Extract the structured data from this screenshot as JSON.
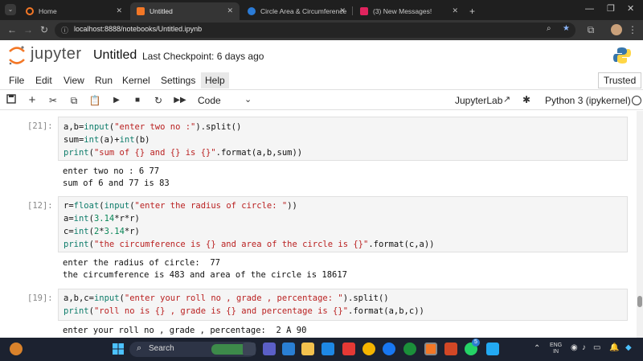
{
  "browser": {
    "tabs": [
      {
        "label": "Home",
        "active": false
      },
      {
        "label": "Untitled",
        "active": true
      },
      {
        "label": "Circle Area & Circumference",
        "active": false
      },
      {
        "label": "(3) New Messages!",
        "active": false
      }
    ],
    "new_tab_symbol": "+",
    "url": "localhost:8888/notebooks/Untitled.ipynb"
  },
  "jupyter": {
    "logo_text": "jupyter",
    "notebook_title": "Untitled",
    "checkpoint": "Last Checkpoint: 6 days ago"
  },
  "menubar": {
    "items": [
      "File",
      "Edit",
      "View",
      "Run",
      "Kernel",
      "Settings",
      "Help"
    ],
    "trusted": "Trusted"
  },
  "toolbar": {
    "cell_type": "Code",
    "jupyterlab": "JupyterLab",
    "kernel": "Python 3 (ipykernel)"
  },
  "cells": [
    {
      "prompt": "[21]:",
      "code": [
        "a,b=input(\"enter two no :\").split()",
        "sum=int(a)+int(b)",
        "print(\"sum of {} and {} is {}\".format(a,b,sum))"
      ],
      "output": [
        "enter two no : 6 77",
        "sum of 6 and 77 is 83"
      ]
    },
    {
      "prompt": "[12]:",
      "code": [
        "r=float(input(\"enter the radius of circle: \"))",
        "a=int(3.14*r*r)",
        "c=int(2*3.14*r)",
        "print(\"the circumference is {} and area of the circle is {}\".format(c,a))"
      ],
      "output": [
        "enter the radius of circle:  77",
        "the circumference is 483 and area of the circle is 18617"
      ]
    },
    {
      "prompt": "[19]:",
      "code": [
        "a,b,c=input(\"enter your roll no , grade , percentage: \").split()",
        "print(\"roll no is {} , grade is {} and percentage is {}\".format(a,b,c))"
      ],
      "output": [
        "enter your roll no , grade , percentage:  2 A 90"
      ]
    }
  ],
  "taskbar": {
    "search_placeholder": "Search",
    "lang_top": "ENG",
    "lang_bottom": "IN",
    "badge_count": "5"
  },
  "colors": {
    "jupyter_orange": "#f37726",
    "string": "#ba2121",
    "number": "#098658",
    "builtin": "#0d7c6a"
  }
}
